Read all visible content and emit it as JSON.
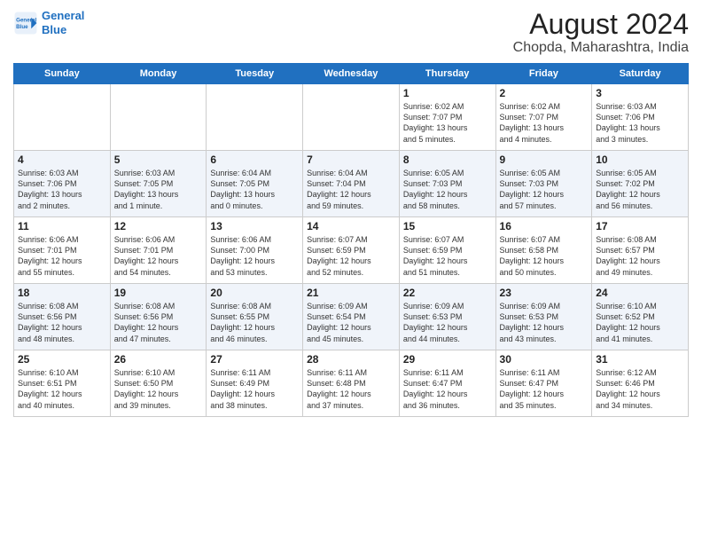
{
  "header": {
    "logo_line1": "General",
    "logo_line2": "Blue",
    "month_year": "August 2024",
    "location": "Chopda, Maharashtra, India"
  },
  "days_of_week": [
    "Sunday",
    "Monday",
    "Tuesday",
    "Wednesday",
    "Thursday",
    "Friday",
    "Saturday"
  ],
  "weeks": [
    [
      {
        "day": "",
        "info": ""
      },
      {
        "day": "",
        "info": ""
      },
      {
        "day": "",
        "info": ""
      },
      {
        "day": "",
        "info": ""
      },
      {
        "day": "1",
        "info": "Sunrise: 6:02 AM\nSunset: 7:07 PM\nDaylight: 13 hours\nand 5 minutes."
      },
      {
        "day": "2",
        "info": "Sunrise: 6:02 AM\nSunset: 7:07 PM\nDaylight: 13 hours\nand 4 minutes."
      },
      {
        "day": "3",
        "info": "Sunrise: 6:03 AM\nSunset: 7:06 PM\nDaylight: 13 hours\nand 3 minutes."
      }
    ],
    [
      {
        "day": "4",
        "info": "Sunrise: 6:03 AM\nSunset: 7:06 PM\nDaylight: 13 hours\nand 2 minutes."
      },
      {
        "day": "5",
        "info": "Sunrise: 6:03 AM\nSunset: 7:05 PM\nDaylight: 13 hours\nand 1 minute."
      },
      {
        "day": "6",
        "info": "Sunrise: 6:04 AM\nSunset: 7:05 PM\nDaylight: 13 hours\nand 0 minutes."
      },
      {
        "day": "7",
        "info": "Sunrise: 6:04 AM\nSunset: 7:04 PM\nDaylight: 12 hours\nand 59 minutes."
      },
      {
        "day": "8",
        "info": "Sunrise: 6:05 AM\nSunset: 7:03 PM\nDaylight: 12 hours\nand 58 minutes."
      },
      {
        "day": "9",
        "info": "Sunrise: 6:05 AM\nSunset: 7:03 PM\nDaylight: 12 hours\nand 57 minutes."
      },
      {
        "day": "10",
        "info": "Sunrise: 6:05 AM\nSunset: 7:02 PM\nDaylight: 12 hours\nand 56 minutes."
      }
    ],
    [
      {
        "day": "11",
        "info": "Sunrise: 6:06 AM\nSunset: 7:01 PM\nDaylight: 12 hours\nand 55 minutes."
      },
      {
        "day": "12",
        "info": "Sunrise: 6:06 AM\nSunset: 7:01 PM\nDaylight: 12 hours\nand 54 minutes."
      },
      {
        "day": "13",
        "info": "Sunrise: 6:06 AM\nSunset: 7:00 PM\nDaylight: 12 hours\nand 53 minutes."
      },
      {
        "day": "14",
        "info": "Sunrise: 6:07 AM\nSunset: 6:59 PM\nDaylight: 12 hours\nand 52 minutes."
      },
      {
        "day": "15",
        "info": "Sunrise: 6:07 AM\nSunset: 6:59 PM\nDaylight: 12 hours\nand 51 minutes."
      },
      {
        "day": "16",
        "info": "Sunrise: 6:07 AM\nSunset: 6:58 PM\nDaylight: 12 hours\nand 50 minutes."
      },
      {
        "day": "17",
        "info": "Sunrise: 6:08 AM\nSunset: 6:57 PM\nDaylight: 12 hours\nand 49 minutes."
      }
    ],
    [
      {
        "day": "18",
        "info": "Sunrise: 6:08 AM\nSunset: 6:56 PM\nDaylight: 12 hours\nand 48 minutes."
      },
      {
        "day": "19",
        "info": "Sunrise: 6:08 AM\nSunset: 6:56 PM\nDaylight: 12 hours\nand 47 minutes."
      },
      {
        "day": "20",
        "info": "Sunrise: 6:08 AM\nSunset: 6:55 PM\nDaylight: 12 hours\nand 46 minutes."
      },
      {
        "day": "21",
        "info": "Sunrise: 6:09 AM\nSunset: 6:54 PM\nDaylight: 12 hours\nand 45 minutes."
      },
      {
        "day": "22",
        "info": "Sunrise: 6:09 AM\nSunset: 6:53 PM\nDaylight: 12 hours\nand 44 minutes."
      },
      {
        "day": "23",
        "info": "Sunrise: 6:09 AM\nSunset: 6:53 PM\nDaylight: 12 hours\nand 43 minutes."
      },
      {
        "day": "24",
        "info": "Sunrise: 6:10 AM\nSunset: 6:52 PM\nDaylight: 12 hours\nand 41 minutes."
      }
    ],
    [
      {
        "day": "25",
        "info": "Sunrise: 6:10 AM\nSunset: 6:51 PM\nDaylight: 12 hours\nand 40 minutes."
      },
      {
        "day": "26",
        "info": "Sunrise: 6:10 AM\nSunset: 6:50 PM\nDaylight: 12 hours\nand 39 minutes."
      },
      {
        "day": "27",
        "info": "Sunrise: 6:11 AM\nSunset: 6:49 PM\nDaylight: 12 hours\nand 38 minutes."
      },
      {
        "day": "28",
        "info": "Sunrise: 6:11 AM\nSunset: 6:48 PM\nDaylight: 12 hours\nand 37 minutes."
      },
      {
        "day": "29",
        "info": "Sunrise: 6:11 AM\nSunset: 6:47 PM\nDaylight: 12 hours\nand 36 minutes."
      },
      {
        "day": "30",
        "info": "Sunrise: 6:11 AM\nSunset: 6:47 PM\nDaylight: 12 hours\nand 35 minutes."
      },
      {
        "day": "31",
        "info": "Sunrise: 6:12 AM\nSunset: 6:46 PM\nDaylight: 12 hours\nand 34 minutes."
      }
    ]
  ]
}
